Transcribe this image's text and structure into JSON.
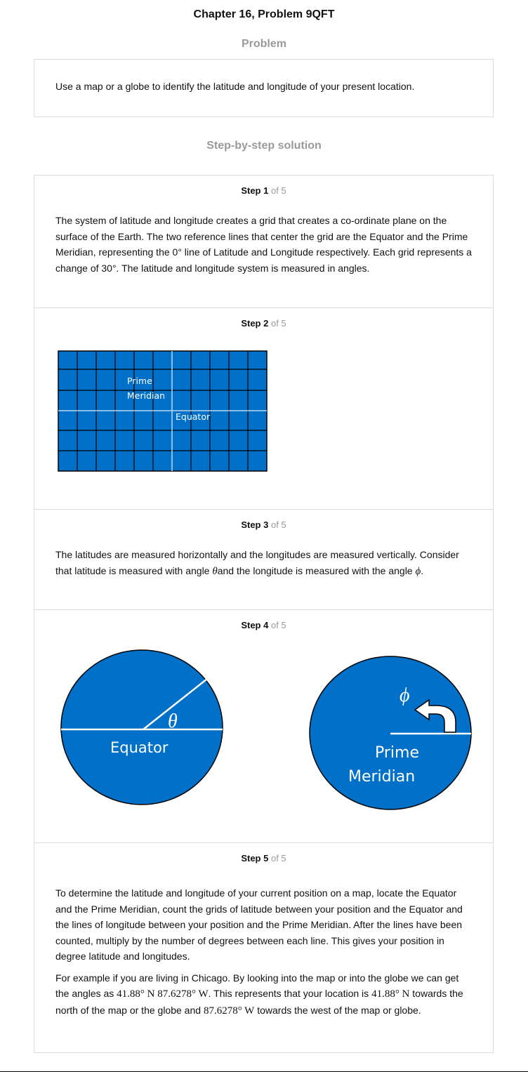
{
  "page": {
    "title": "Chapter 16, Problem 9QFT",
    "problem_heading": "Problem",
    "solution_heading": "Step-by-step solution"
  },
  "problem": {
    "text": "Use a map or a globe to identify the latitude and longitude of your present location."
  },
  "steps": [
    {
      "label": "Step 1",
      "of": "of 5",
      "paragraph": "The system of latitude and longitude creates a grid that creates a co-ordinate plane on the surface of the Earth. The two reference lines that center the grid are the Equator and the Prime Meridian, representing the 0° line of Latitude and Longitude respectively. Each grid represents a change of 30°. The latitude and longitude system is measured in angles."
    },
    {
      "label": "Step 2",
      "of": "of 5",
      "grid": {
        "prime_label_1": "Prime",
        "prime_label_2": "Meridian",
        "equator_label": "Equator",
        "fill_color": "#0070c8"
      }
    },
    {
      "label": "Step 3",
      "of": "of 5",
      "text_a": "The latitudes are measured horizontally and the longitudes are measured vertically. Consider that latitude is measured with angle ",
      "theta": "θ",
      "text_b": "and the longitude is measured with the angle ",
      "phi": "ϕ",
      "text_c": "."
    },
    {
      "label": "Step 4",
      "of": "of 5",
      "left_circle": {
        "angle_symbol": "θ",
        "label": "Equator"
      },
      "right_circle": {
        "angle_symbol": "ϕ",
        "label_1": "Prime",
        "label_2": "Meridian"
      }
    },
    {
      "label": "Step 5",
      "of": "of 5",
      "paragraph_1": "To determine the latitude and longitude of your current position on a map, locate the Equator and the Prime Meridian, count the grids of latitude between your position and the Equator and the lines of longitude between your position and the Prime Meridian. After the lines have been counted, multiply by the number of degrees between each line. This gives your position in degree latitude and longitudes.",
      "p2_a": "For example if you are living in Chicago. By looking into the map or into the globe we can get the angles as ",
      "p2_math_1": "41.88° N  87.6278° W",
      "p2_b": ". This represents that your location is ",
      "p2_math_2": "41.88° N",
      "p2_c": " towards the north of the map or the globe and ",
      "p2_math_3": "87.6278° W",
      "p2_d": " towards the west of the map or globe."
    }
  ]
}
